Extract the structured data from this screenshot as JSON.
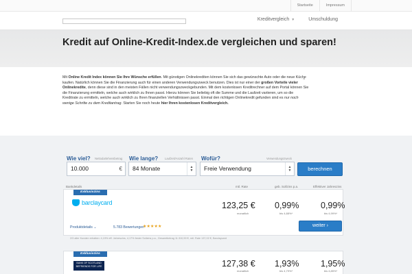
{
  "top_links": [
    "Startseite",
    "Impressum"
  ],
  "nav": {
    "item1": "Kreditvergleich",
    "item2": "Umschuldung"
  },
  "hero": {
    "title": "Kredit auf Online-Kredit-Index.de vergleichen und sparen!"
  },
  "intro": {
    "t1": "Mit ",
    "b1": "Online Kredit Index können Sie Ihre Wünsche erfüllen",
    "t2": ". Mit günstigen Onlinekrediten können Sie sich das gewünschte Auto oder die neue Küche kaufen. Natürlich können Sie die Finanzierung auch für einen anderen Verwendungszweck benutzen. Dies ist nur einer der ",
    "b2": "großen Vorteile vieler Onlinekredite",
    "t3": ", denn diese sind in den meisten Fällen nicht verwendungszweckgebunden. Mit dem kostenlosen Kreditrechner auf dem Portal können Sie die Finanzierung ermitteln, welche auch wirklich zu Ihnen passt. Hierzu können Sie beliebig oft die Summe und die Laufzeit variieren, um so die Kreditrate zu ermitteln, welche auch wirklich zu Ihren finanziellen Verhältnissen passt. Einmal den richtigen Onlinekredit gefunden sind es ",
    "i1": "nur noch wenige Schritte zu dem Kreditantrag",
    "t4": ". Starten Sie noch heute ",
    "b3": "hier Ihren kostenlosen Kreditvergleich.",
    "close": "×"
  },
  "form": {
    "amount_label": "Wie viel?",
    "amount_hint": "Nettodarlehensbetrag",
    "amount_value": "10.000",
    "amount_suffix": "€",
    "duration_label": "Wie lange?",
    "duration_hint": "Laufzeit/Anzahl Raten",
    "duration_value": "84 Monate",
    "purpose_label": "Wofür?",
    "purpose_hint": "Verwendungszweck",
    "purpose_value": "Freie Verwendung",
    "search_button": "berechnen"
  },
  "columns": {
    "bank": "Bankdetails",
    "rate": "mtl. Rate",
    "sollzins": "geb. Sollzins p.a.",
    "eff": "Effektiver Jahreszins"
  },
  "offers": [
    {
      "flag": "Exklusivzins",
      "bank": "barclaycard",
      "monthly": "123,25 €",
      "monthly_sub": "monatlich",
      "sollzins": "0,99%",
      "sollzins_sub": "bis 4,88%*",
      "eff": "0,99%",
      "eff_sub": "bis 4,99%*",
      "details": "Produktdetails",
      "details_chev": "⌄",
      "reviews": "5.783 Bewertungen",
      "stars": "★★★★★",
      "button": "weiter ›",
      "footnote": "2/3 aller Kunden erhalten: 4,19% eff. Jahreszins, 4,17% fester Sollzins p.a., Gesamtbetrag 11.310,59 €, mtl. Rate 137,02 €, Barclaycard"
    },
    {
      "flag": "Exklusivzins",
      "bank": "BANK OF SCOTLAND",
      "bank_sub": "BEFRIENDS FOR LIFE",
      "monthly": "127,38 €",
      "monthly_sub": "monatlich",
      "sollzins": "1,93%",
      "sollzins_sub": "bis 4,79%*",
      "eff": "1,95%",
      "eff_sub": "bis 4,85%*"
    }
  ],
  "colors": {
    "accent": "#2a7dc7",
    "label": "#2c5d97",
    "star": "#e8a21a"
  }
}
